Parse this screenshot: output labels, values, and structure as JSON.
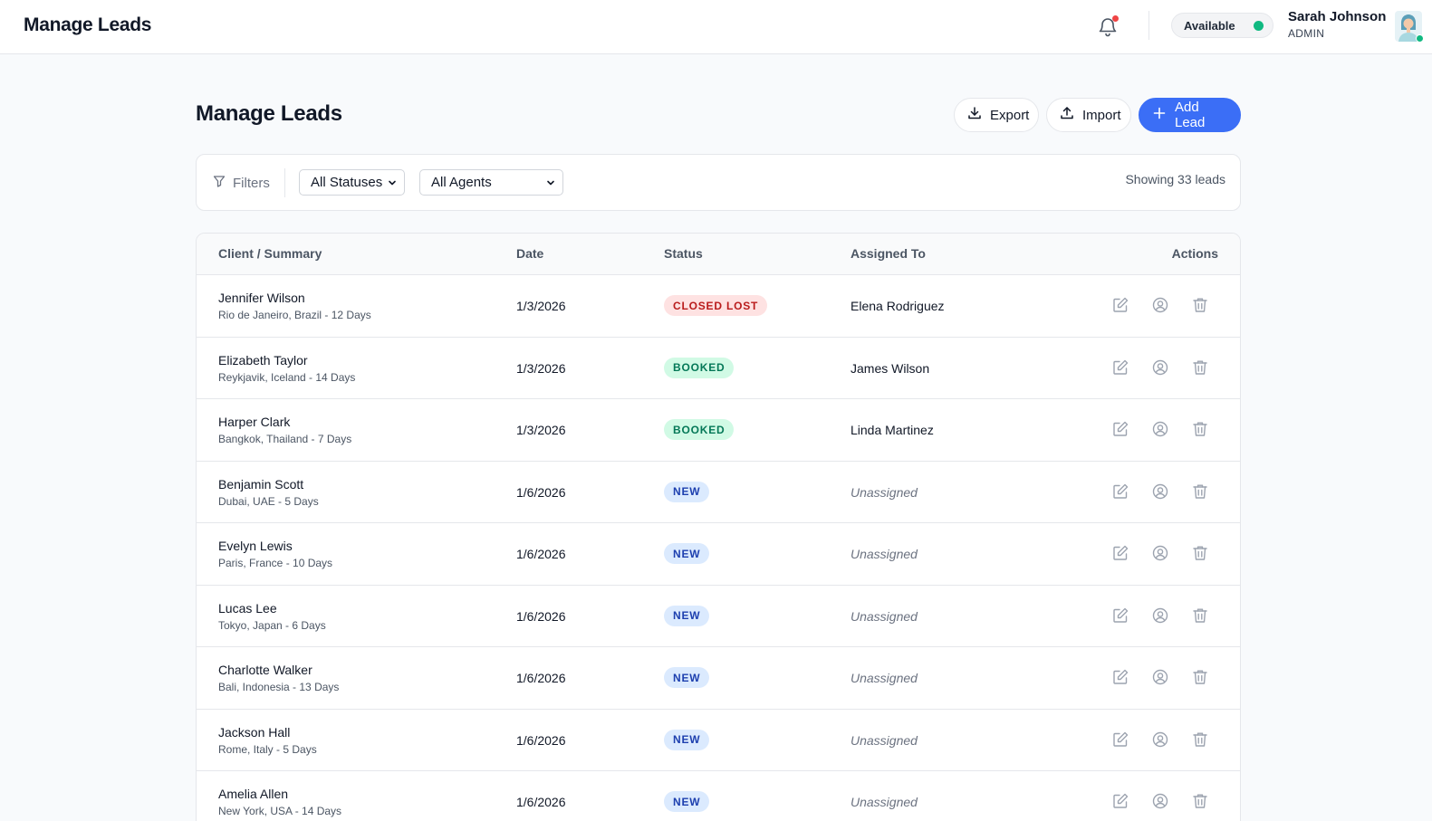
{
  "app": {
    "title": "Manage Leads",
    "user": {
      "name": "Sarah Johnson",
      "role": "ADMIN"
    },
    "availability": "Available"
  },
  "page": {
    "title": "Manage Leads",
    "buttons": {
      "export": "Export",
      "import": "Import",
      "add": "Add Lead"
    }
  },
  "filters": {
    "label": "Filters",
    "status_selected": "All Statuses",
    "agent_selected": "All Agents",
    "showing": "Showing 33 leads"
  },
  "table": {
    "headers": {
      "client": "Client / Summary",
      "date": "Date",
      "status": "Status",
      "assigned": "Assigned To",
      "actions": "Actions"
    },
    "rows": [
      {
        "name": "Jennifer Wilson",
        "summary": "Rio de Janeiro, Brazil - 12 Days",
        "date": "1/3/2026",
        "status": "CLOSED LOST",
        "status_kind": "closed-lost",
        "agent": "Elena Rodriguez",
        "unassigned": false
      },
      {
        "name": "Elizabeth Taylor",
        "summary": "Reykjavik, Iceland - 14 Days",
        "date": "1/3/2026",
        "status": "BOOKED",
        "status_kind": "booked",
        "agent": "James Wilson",
        "unassigned": false
      },
      {
        "name": "Harper Clark",
        "summary": "Bangkok, Thailand - 7 Days",
        "date": "1/3/2026",
        "status": "BOOKED",
        "status_kind": "booked",
        "agent": "Linda Martinez",
        "unassigned": false
      },
      {
        "name": "Benjamin Scott",
        "summary": "Dubai, UAE - 5 Days",
        "date": "1/6/2026",
        "status": "NEW",
        "status_kind": "new",
        "agent": "Unassigned",
        "unassigned": true
      },
      {
        "name": "Evelyn Lewis",
        "summary": "Paris, France - 10 Days",
        "date": "1/6/2026",
        "status": "NEW",
        "status_kind": "new",
        "agent": "Unassigned",
        "unassigned": true
      },
      {
        "name": "Lucas Lee",
        "summary": "Tokyo, Japan - 6 Days",
        "date": "1/6/2026",
        "status": "NEW",
        "status_kind": "new",
        "agent": "Unassigned",
        "unassigned": true
      },
      {
        "name": "Charlotte Walker",
        "summary": "Bali, Indonesia - 13 Days",
        "date": "1/6/2026",
        "status": "NEW",
        "status_kind": "new",
        "agent": "Unassigned",
        "unassigned": true
      },
      {
        "name": "Jackson Hall",
        "summary": "Rome, Italy - 5 Days",
        "date": "1/6/2026",
        "status": "NEW",
        "status_kind": "new",
        "agent": "Unassigned",
        "unassigned": true
      },
      {
        "name": "Amelia Allen",
        "summary": "New York, USA - 14 Days",
        "date": "1/6/2026",
        "status": "NEW",
        "status_kind": "new",
        "agent": "Unassigned",
        "unassigned": true
      }
    ]
  },
  "icons": {
    "bell": "bell-icon",
    "export": "download-icon",
    "import": "upload-icon",
    "add": "plus-icon",
    "filter": "filter-icon",
    "edit": "edit-icon",
    "assign": "user-circle-icon",
    "delete": "trash-icon"
  },
  "colors": {
    "accent": "#3b6ef6",
    "online": "#10b981",
    "notification": "#ef4444"
  }
}
